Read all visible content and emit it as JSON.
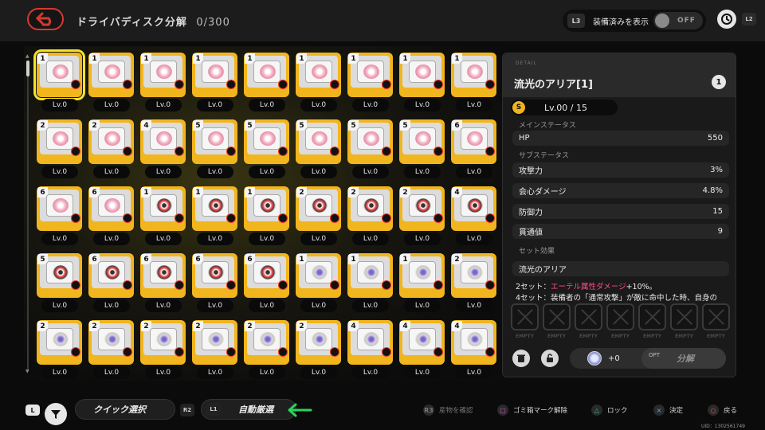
{
  "header": {
    "title": "ドライバディスク分解",
    "count": "0/300",
    "show_equipped_badge": "L3",
    "show_equipped_label": "装備済みを表示",
    "show_equipped_state": "OFF",
    "sort_badge": "L2"
  },
  "grid": {
    "tiles": [
      {
        "slot": "1",
        "level": "Lv.0",
        "type": "pink"
      },
      {
        "slot": "1",
        "level": "Lv.0",
        "type": "pink"
      },
      {
        "slot": "1",
        "level": "Lv.0",
        "type": "pink"
      },
      {
        "slot": "1",
        "level": "Lv.0",
        "type": "pink"
      },
      {
        "slot": "1",
        "level": "Lv.0",
        "type": "pink"
      },
      {
        "slot": "1",
        "level": "Lv.0",
        "type": "pink"
      },
      {
        "slot": "1",
        "level": "Lv.0",
        "type": "pink"
      },
      {
        "slot": "1",
        "level": "Lv.0",
        "type": "pink"
      },
      {
        "slot": "1",
        "level": "Lv.0",
        "type": "pink"
      },
      {
        "slot": "2",
        "level": "Lv.0",
        "type": "pink"
      },
      {
        "slot": "2",
        "level": "Lv.0",
        "type": "pink"
      },
      {
        "slot": "4",
        "level": "Lv.0",
        "type": "pink"
      },
      {
        "slot": "5",
        "level": "Lv.0",
        "type": "pink"
      },
      {
        "slot": "5",
        "level": "Lv.0",
        "type": "pink"
      },
      {
        "slot": "5",
        "level": "Lv.0",
        "type": "pink"
      },
      {
        "slot": "5",
        "level": "Lv.0",
        "type": "pink"
      },
      {
        "slot": "5",
        "level": "Lv.0",
        "type": "pink"
      },
      {
        "slot": "6",
        "level": "Lv.0",
        "type": "pink"
      },
      {
        "slot": "6",
        "level": "Lv.0",
        "type": "pink"
      },
      {
        "slot": "6",
        "level": "Lv.0",
        "type": "pink"
      },
      {
        "slot": "1",
        "level": "Lv.0",
        "type": "red"
      },
      {
        "slot": "1",
        "level": "Lv.0",
        "type": "red"
      },
      {
        "slot": "1",
        "level": "Lv.0",
        "type": "red"
      },
      {
        "slot": "2",
        "level": "Lv.0",
        "type": "red"
      },
      {
        "slot": "2",
        "level": "Lv.0",
        "type": "red"
      },
      {
        "slot": "2",
        "level": "Lv.0",
        "type": "red"
      },
      {
        "slot": "4",
        "level": "Lv.0",
        "type": "red"
      },
      {
        "slot": "5",
        "level": "Lv.0",
        "type": "red"
      },
      {
        "slot": "6",
        "level": "Lv.0",
        "type": "red"
      },
      {
        "slot": "6",
        "level": "Lv.0",
        "type": "red"
      },
      {
        "slot": "6",
        "level": "Lv.0",
        "type": "red"
      },
      {
        "slot": "6",
        "level": "Lv.0",
        "type": "red"
      },
      {
        "slot": "1",
        "level": "Lv.0",
        "type": "gray"
      },
      {
        "slot": "1",
        "level": "Lv.0",
        "type": "gray"
      },
      {
        "slot": "1",
        "level": "Lv.0",
        "type": "gray"
      },
      {
        "slot": "2",
        "level": "Lv.0",
        "type": "gray"
      },
      {
        "slot": "2",
        "level": "Lv.0",
        "type": "gray"
      },
      {
        "slot": "2",
        "level": "Lv.0",
        "type": "gray"
      },
      {
        "slot": "2",
        "level": "Lv.0",
        "type": "gray"
      },
      {
        "slot": "2",
        "level": "Lv.0",
        "type": "gray"
      },
      {
        "slot": "2",
        "level": "Lv.0",
        "type": "gray"
      },
      {
        "slot": "2",
        "level": "Lv.0",
        "type": "gray"
      },
      {
        "slot": "4",
        "level": "Lv.0",
        "type": "gray"
      },
      {
        "slot": "4",
        "level": "Lv.0",
        "type": "gray"
      },
      {
        "slot": "4",
        "level": "Lv.0",
        "type": "gray"
      }
    ]
  },
  "detail": {
    "caption": "DETAIL",
    "name": "流光のアリア[1]",
    "slot": "1",
    "level_icon": "S",
    "level": "Lv.00 / 15",
    "main_label": "メインステータス",
    "main_stat": {
      "name": "HP",
      "value": "550"
    },
    "sub_label": "サブステータス",
    "sub_stats": [
      {
        "name": "攻撃力",
        "value": "3%"
      },
      {
        "name": "会心ダメージ",
        "value": "4.8%"
      },
      {
        "name": "防御力",
        "value": "15"
      },
      {
        "name": "貫通値",
        "value": "9"
      }
    ],
    "set_label": "セット効果",
    "set_name": "流光のアリア",
    "set2_prefix": "2セット：",
    "set2_highlight": "エーテル属性ダメージ",
    "set2_suffix": "+10%。",
    "set4_text": "4セット：装備者の「通常攻撃」が敵に命中した時、自身の",
    "empty_label": "EMPTY",
    "material_value": "+0",
    "dismantle_badge": "OPT",
    "dismantle_label": "分解"
  },
  "bottom": {
    "left_badge": "L",
    "quick_select_label": "クイック選択",
    "r2_badge": "R2",
    "l1_badge": "L1",
    "auto_select_label": "自動厳選",
    "hints": [
      {
        "glyph": "R3",
        "label": "産物を確認",
        "dim": true
      },
      {
        "glyph": "□",
        "label": "ゴミ箱マーク解除",
        "dim": false,
        "color": "#d05bd0"
      },
      {
        "glyph": "△",
        "label": "ロック",
        "dim": false,
        "color": "#3fbf8f"
      },
      {
        "glyph": "×",
        "label": "決定",
        "dim": false,
        "color": "#4a8fe0"
      },
      {
        "glyph": "○",
        "label": "戻る",
        "dim": false,
        "color": "#e05050"
      }
    ],
    "uid": "UID：1302561749"
  },
  "colors": {
    "accent_gold": "#f1b51e",
    "selected": "#f3e22a",
    "arrow": "#27d65a",
    "highlight_pink": "#ff4e82"
  }
}
